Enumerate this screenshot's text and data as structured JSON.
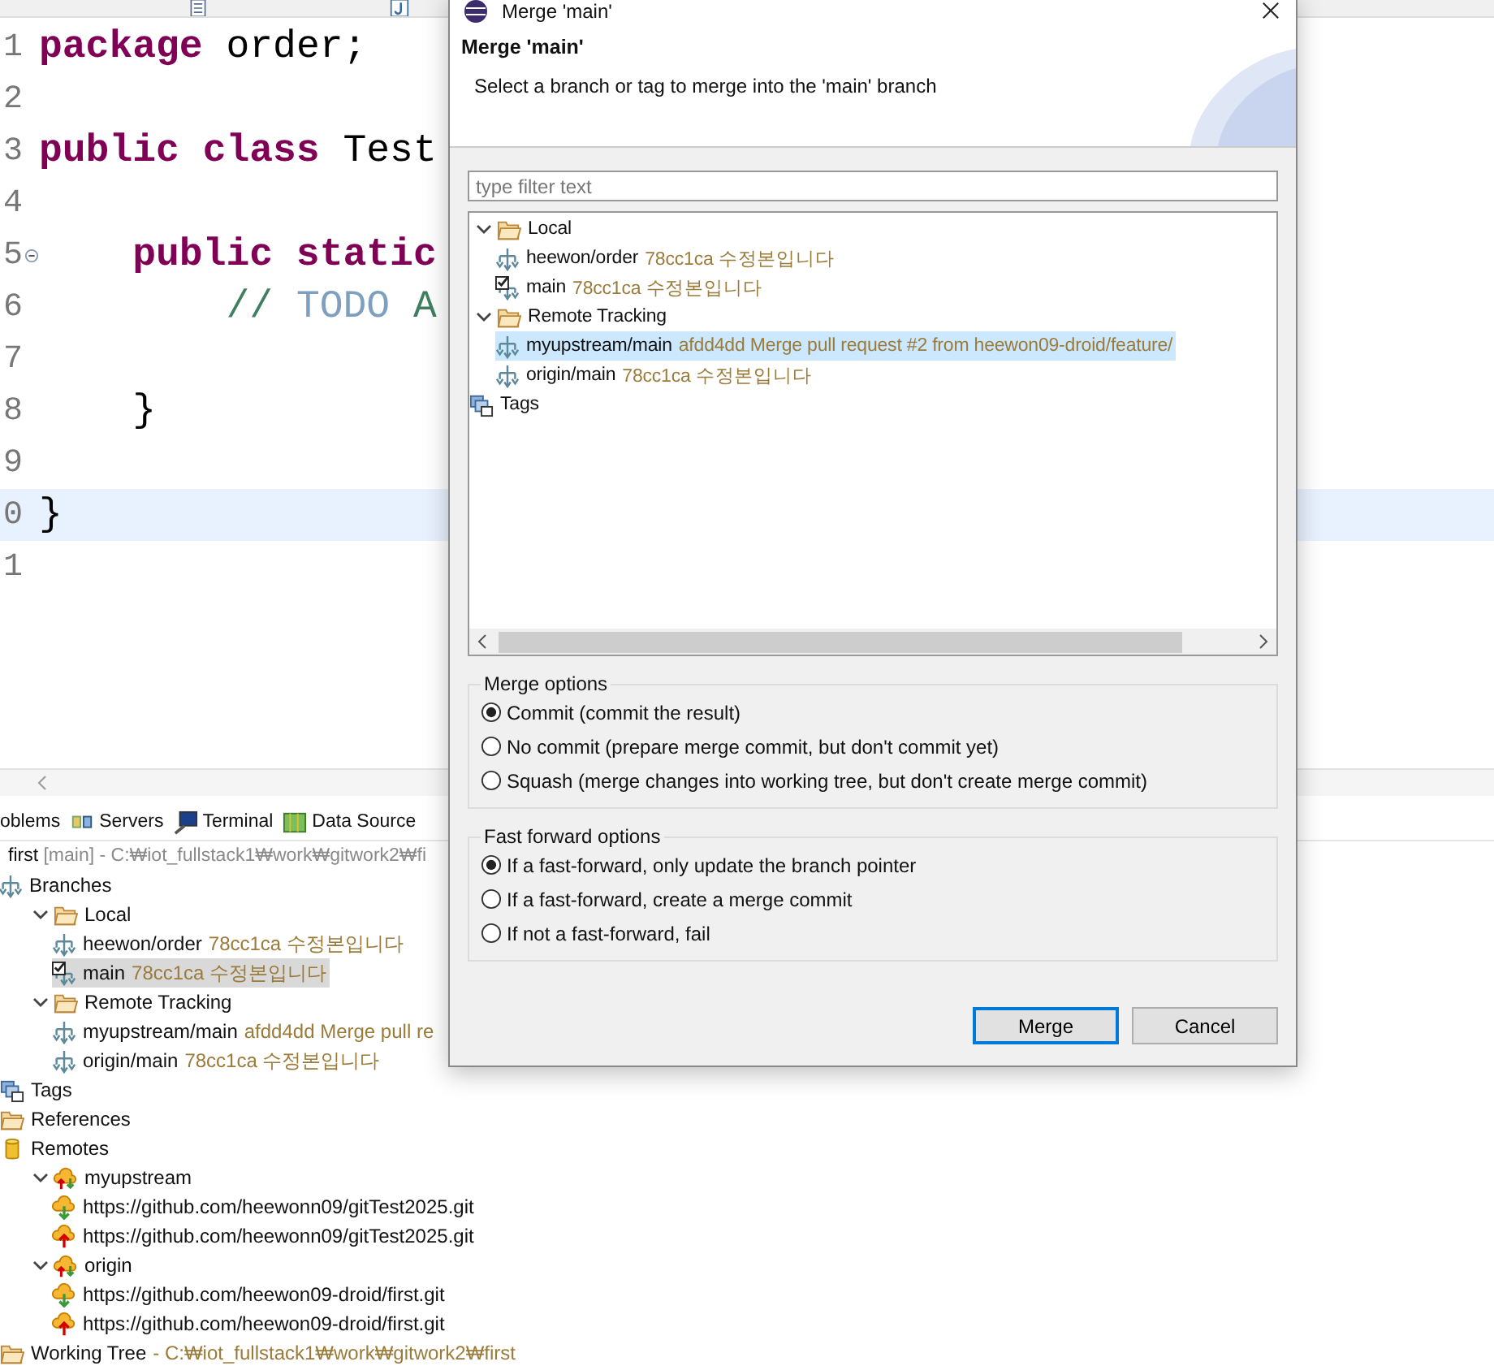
{
  "editor": {
    "tabs": [
      {
        "kind": "text"
      },
      {
        "kind": "java"
      }
    ],
    "lines": [
      {
        "number": "1",
        "tokens": [
          {
            "text": "package",
            "kind": "keyword"
          },
          {
            "text": " order;",
            "kind": "plain"
          }
        ]
      },
      {
        "number": "2"
      },
      {
        "number": "3",
        "tokens": [
          {
            "text": "public class",
            "kind": "keyword"
          },
          {
            "text": " Test",
            "kind": "plain"
          }
        ]
      },
      {
        "number": "4"
      },
      {
        "number": "5",
        "foldable": true,
        "tokens": [
          {
            "text": "    public static",
            "kind": "keyword"
          }
        ]
      },
      {
        "number": "6",
        "tokens": [
          {
            "text": "        // ",
            "kind": "comment"
          },
          {
            "text": "TODO",
            "kind": "todo"
          },
          {
            "text": " A",
            "kind": "comment"
          }
        ]
      },
      {
        "number": "7"
      },
      {
        "number": "8",
        "tokens": [
          {
            "text": "    }",
            "kind": "plain"
          }
        ]
      },
      {
        "number": "9"
      },
      {
        "number": "0",
        "current": true,
        "tokens": [
          {
            "text": "}",
            "kind": "plain"
          }
        ]
      },
      {
        "number": "1"
      }
    ]
  },
  "views": [
    {
      "label": "oblems",
      "kind": "problems"
    },
    {
      "label": "Servers",
      "kind": "servers"
    },
    {
      "label": "Terminal",
      "kind": "terminal"
    },
    {
      "label": "Data Source",
      "kind": "datasource"
    }
  ],
  "repository": {
    "name": "first",
    "branch": "[main]",
    "path": "- C:₩iot_fullstack1₩work₩gitwork2₩fi"
  },
  "repo_tree": [
    {
      "label": "Branches",
      "kind": "branches",
      "expanded": true,
      "children": [
        {
          "label": "Local",
          "kind": "folder",
          "expanded": true,
          "children": [
            {
              "label": "heewon/order",
              "detail": "78cc1ca 수정본입니다",
              "kind": "branch",
              "selected": false
            },
            {
              "label": "main",
              "detail": "78cc1ca 수정본입니다",
              "kind": "checked-branch",
              "selected": true
            }
          ]
        },
        {
          "label": "Remote Tracking",
          "kind": "folder",
          "expanded": true,
          "children": [
            {
              "label": "myupstream/main",
              "detail": "afdd4dd Merge pull re",
              "kind": "branch",
              "selected": false
            },
            {
              "label": "origin/main",
              "detail": "78cc1ca 수정본입니다",
              "kind": "branch",
              "selected": false
            }
          ]
        }
      ]
    },
    {
      "label": "Tags",
      "kind": "tags"
    },
    {
      "label": "References",
      "kind": "folder"
    },
    {
      "label": "Remotes",
      "kind": "remotes",
      "expanded": true,
      "children": [
        {
          "label": "myupstream",
          "kind": "remote",
          "expanded": true,
          "children": [
            {
              "label": "https://github.com/heewonn09/gitTest2025.git",
              "kind": "fetch"
            },
            {
              "label": "https://github.com/heewonn09/gitTest2025.git",
              "kind": "push"
            }
          ]
        },
        {
          "label": "origin",
          "kind": "remote",
          "expanded": true,
          "children": [
            {
              "label": "https://github.com/heewon09-droid/first.git",
              "kind": "fetch"
            },
            {
              "label": "https://github.com/heewon09-droid/first.git",
              "kind": "push"
            }
          ]
        }
      ]
    },
    {
      "label": "Working Tree",
      "detail": "- C:₩iot_fullstack1₩work₩gitwork2₩first",
      "kind": "folder"
    }
  ],
  "dialog": {
    "title": "Merge 'main'",
    "heading": "Merge 'main'",
    "description": "Select a branch or tag to merge into the 'main' branch",
    "filter": {
      "placeholder": "type filter text"
    },
    "tree": [
      {
        "label": "Local",
        "kind": "folder",
        "expanded": true,
        "children": [
          {
            "label": "heewon/order",
            "detail": "78cc1ca 수정본입니다",
            "kind": "branch",
            "selected": false
          },
          {
            "label": "main",
            "detail": "78cc1ca 수정본입니다",
            "kind": "checked-branch",
            "selected": false
          }
        ]
      },
      {
        "label": "Remote Tracking",
        "kind": "folder",
        "expanded": true,
        "children": [
          {
            "label": "myupstream/main",
            "detail": "afdd4dd Merge pull request #2 from heewon09-droid/feature/",
            "kind": "branch",
            "selected": true
          },
          {
            "label": "origin/main",
            "detail": "78cc1ca 수정본입니다",
            "kind": "branch",
            "selected": false
          }
        ]
      },
      {
        "label": "Tags",
        "kind": "tags"
      }
    ],
    "groups": [
      {
        "title": "Merge options",
        "options": [
          {
            "label": "Commit (commit the result)",
            "selected": true
          },
          {
            "label": "No commit (prepare merge commit, but don't commit yet)",
            "selected": false
          },
          {
            "label": "Squash (merge changes into working tree, but don't create merge commit)",
            "selected": false
          }
        ]
      },
      {
        "title": "Fast forward options",
        "options": [
          {
            "label": "If a fast-forward, only update the branch pointer",
            "selected": true
          },
          {
            "label": "If a fast-forward, create a merge commit",
            "selected": false
          },
          {
            "label": "If not a fast-forward, fail",
            "selected": false
          }
        ]
      }
    ],
    "buttons": [
      {
        "label": "Merge",
        "default": true
      },
      {
        "label": "Cancel",
        "default": false
      }
    ]
  }
}
